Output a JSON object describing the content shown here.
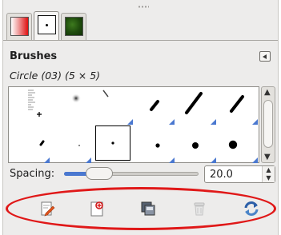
{
  "tabs": [
    {
      "name": "gradients"
    },
    {
      "name": "brushes",
      "active": true
    },
    {
      "name": "patterns"
    }
  ],
  "panel": {
    "title": "Brushes",
    "menu_icon": "triangle-left-icon",
    "selected_brush": "Circle (03) (5 × 5)"
  },
  "spacing": {
    "label": "Spacing:",
    "value": "20.0",
    "slider_fraction": 0.2
  },
  "toolbar": [
    {
      "icon": "edit-brush-icon"
    },
    {
      "icon": "new-brush-icon"
    },
    {
      "icon": "duplicate-brush-icon"
    },
    {
      "icon": "delete-brush-icon",
      "disabled": true
    },
    {
      "icon": "refresh-brushes-icon"
    }
  ],
  "colors": {
    "selection_marker": "#4a78d0",
    "annotation_ring": "#e01818"
  }
}
